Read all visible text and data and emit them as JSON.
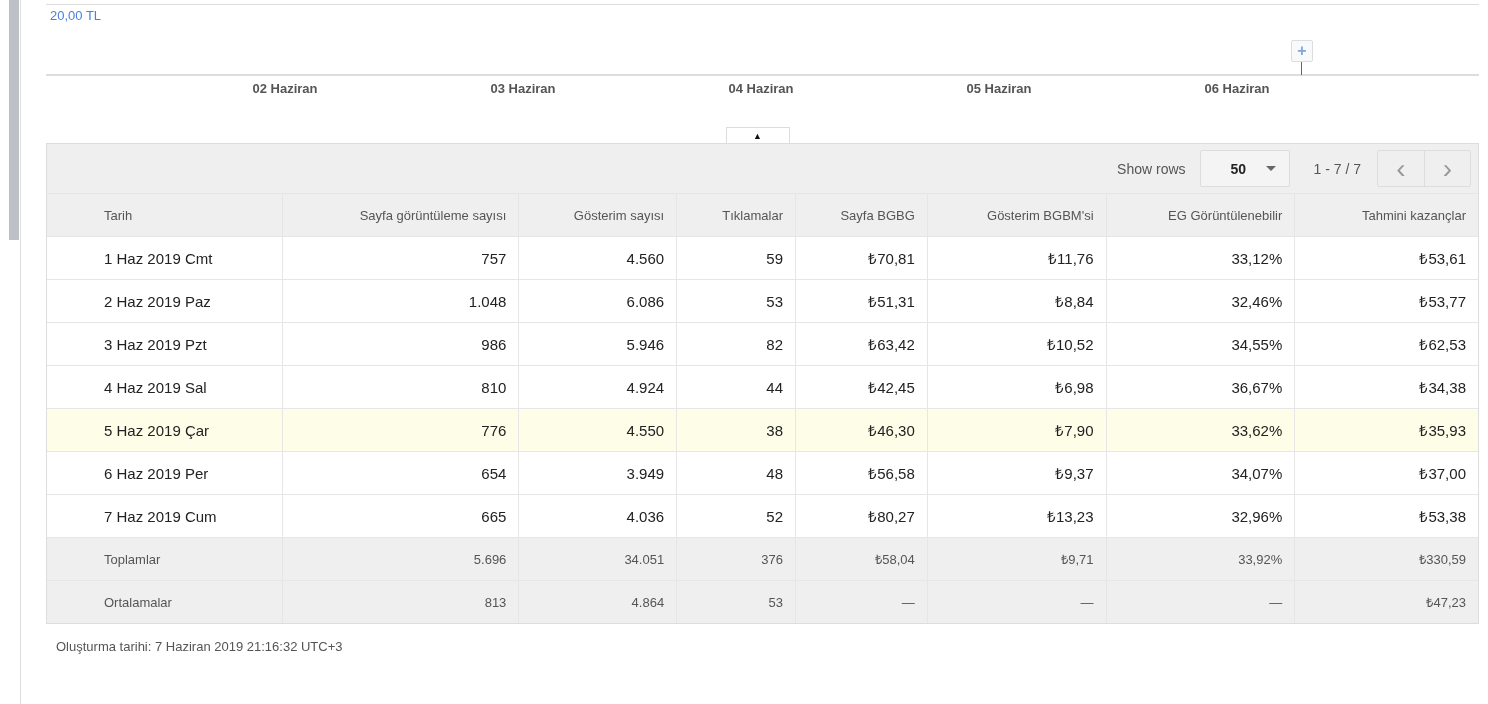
{
  "chart": {
    "y_label": "20,00 TL",
    "x_labels": [
      "02 Haziran",
      "03 Haziran",
      "04 Haziran",
      "05 Haziran",
      "06 Haziran"
    ],
    "marker_symbol": "+"
  },
  "collapse_toggle": "▲",
  "table": {
    "show_rows_label": "Show rows",
    "rows_per_page": "50",
    "range": "1 - 7 / 7",
    "prev": "‹",
    "next": "›",
    "columns": [
      "Tarih",
      "Sayfa görüntüleme sayısı",
      "Gösterim sayısı",
      "Tıklamalar",
      "Sayfa BGBG",
      "Gösterim BGBM'si",
      "EG Görüntülenebilir",
      "Tahmini kazançlar"
    ],
    "rows": [
      {
        "cells": [
          "1 Haz 2019 Cmt",
          "757",
          "4.560",
          "59",
          "₺70,81",
          "₺11,76",
          "33,12%",
          "₺53,61"
        ],
        "highlighted": false
      },
      {
        "cells": [
          "2 Haz 2019 Paz",
          "1.048",
          "6.086",
          "53",
          "₺51,31",
          "₺8,84",
          "32,46%",
          "₺53,77"
        ],
        "highlighted": false
      },
      {
        "cells": [
          "3 Haz 2019 Pzt",
          "986",
          "5.946",
          "82",
          "₺63,42",
          "₺10,52",
          "34,55%",
          "₺62,53"
        ],
        "highlighted": false
      },
      {
        "cells": [
          "4 Haz 2019 Sal",
          "810",
          "4.924",
          "44",
          "₺42,45",
          "₺6,98",
          "36,67%",
          "₺34,38"
        ],
        "highlighted": false
      },
      {
        "cells": [
          "5 Haz 2019 Çar",
          "776",
          "4.550",
          "38",
          "₺46,30",
          "₺7,90",
          "33,62%",
          "₺35,93"
        ],
        "highlighted": true
      },
      {
        "cells": [
          "6 Haz 2019 Per",
          "654",
          "3.949",
          "48",
          "₺56,58",
          "₺9,37",
          "34,07%",
          "₺37,00"
        ],
        "highlighted": false
      },
      {
        "cells": [
          "7 Haz 2019 Cum",
          "665",
          "4.036",
          "52",
          "₺80,27",
          "₺13,23",
          "32,96%",
          "₺53,38"
        ],
        "highlighted": false
      }
    ],
    "summary_rows": [
      {
        "cells": [
          "Toplamlar",
          "5.696",
          "34.051",
          "376",
          "₺58,04",
          "₺9,71",
          "33,92%",
          "₺330,59"
        ]
      },
      {
        "cells": [
          "Ortalamalar",
          "813",
          "4.864",
          "53",
          "—",
          "—",
          "—",
          "₺47,23"
        ]
      }
    ]
  },
  "footer": "Oluşturma tarihi: 7 Haziran 2019 21:16:32 UTC+3"
}
